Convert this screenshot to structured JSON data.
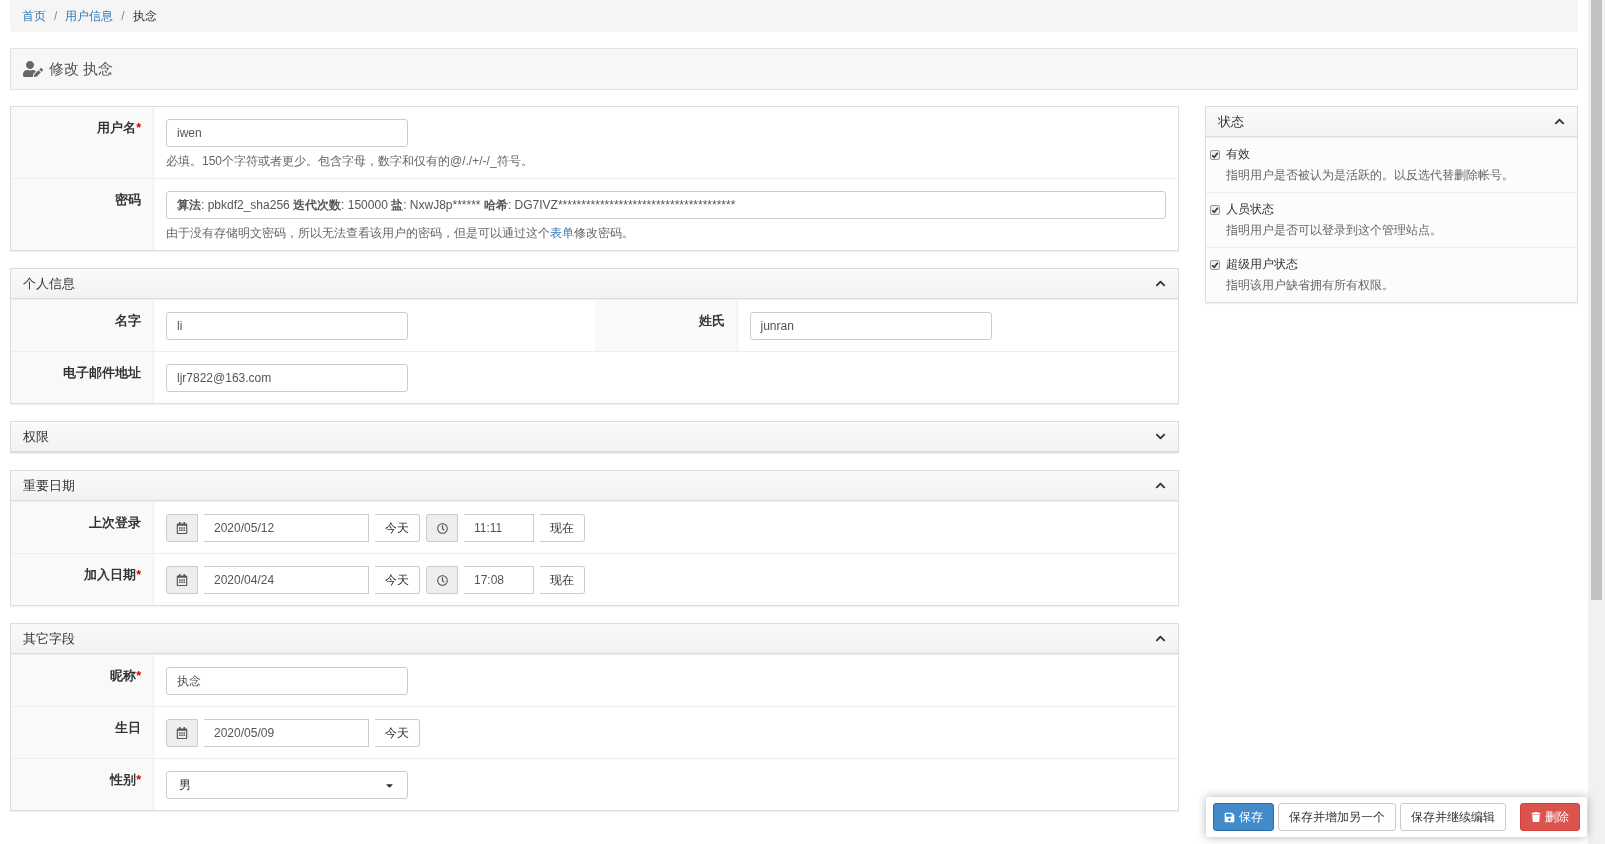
{
  "breadcrumb_separator": "/",
  "required_mark": "*",
  "breadcrumb": [
    {
      "label": "首页",
      "link": true
    },
    {
      "label": "用户信息",
      "link": true
    },
    {
      "label": "执念",
      "link": false
    }
  ],
  "page_title": "修改 执念",
  "account": {
    "rows": [
      {
        "label": "用户名",
        "required": true,
        "kind": "text",
        "value": "iwen",
        "help": {
          "before": "必填。150个字符或者更少。包含字母，数字和仅有的@/./+/-/_符号。"
        }
      },
      {
        "label": "密码",
        "required": false,
        "kind": "password",
        "parts": [
          {
            "label": "算法",
            "value": ": pbkdf2_sha256"
          },
          {
            "label": "迭代次数",
            "value": ": 150000"
          },
          {
            "label": "盐",
            "value": ": NxwJ8p******"
          },
          {
            "label": "哈希",
            "value": ": DG7IVZ**************************************"
          }
        ],
        "help": {
          "before": "由于没有存储明文密码，所以无法查看该用户的密码，但是可以通过这个",
          "link": "表单",
          "after": "修改密码。"
        }
      }
    ]
  },
  "sections": [
    {
      "title": "个人信息",
      "expanded": true,
      "rows": [
        [
          {
            "label": "名字",
            "required": false,
            "kind": "text",
            "value": "li"
          },
          {
            "label": "姓氏",
            "required": false,
            "kind": "text",
            "value": "junran"
          }
        ],
        [
          {
            "label": "电子邮件地址",
            "required": false,
            "kind": "text",
            "value": "ljr7822@163.com"
          }
        ]
      ]
    },
    {
      "title": "权限",
      "expanded": false
    },
    {
      "title": "重要日期",
      "expanded": true,
      "rows": [
        [
          {
            "label": "上次登录",
            "required": false,
            "kind": "datetime",
            "date": "2020/05/12",
            "today": "今天",
            "time": "11:11",
            "now": "现在"
          }
        ],
        [
          {
            "label": "加入日期",
            "required": true,
            "kind": "datetime",
            "date": "2020/04/24",
            "today": "今天",
            "time": "17:08",
            "now": "现在"
          }
        ]
      ]
    },
    {
      "title": "其它字段",
      "expanded": true,
      "rows": [
        [
          {
            "label": "昵称",
            "required": true,
            "kind": "text",
            "value": "执念"
          }
        ],
        [
          {
            "label": "生日",
            "required": false,
            "kind": "date",
            "date": "2020/05/09",
            "today": "今天"
          }
        ],
        [
          {
            "label": "性别",
            "required": true,
            "kind": "select",
            "value": "男"
          }
        ]
      ]
    }
  ],
  "status_panel": {
    "title": "状态",
    "expanded": true,
    "items": [
      {
        "label": "有效",
        "help": "指明用户是否被认为是活跃的。以反选代替删除帐号。",
        "checked": true
      },
      {
        "label": "人员状态",
        "help": "指明用户是否可以登录到这个管理站点。",
        "checked": true
      },
      {
        "label": "超级用户状态",
        "help": "指明该用户缺省拥有所有权限。",
        "checked": true
      }
    ]
  },
  "actions": [
    {
      "label": "保存",
      "kind": "primary"
    },
    {
      "label": "保存并增加另一个",
      "kind": "default"
    },
    {
      "label": "保存并继续编辑",
      "kind": "default"
    },
    {
      "label": "删除",
      "kind": "danger"
    }
  ]
}
